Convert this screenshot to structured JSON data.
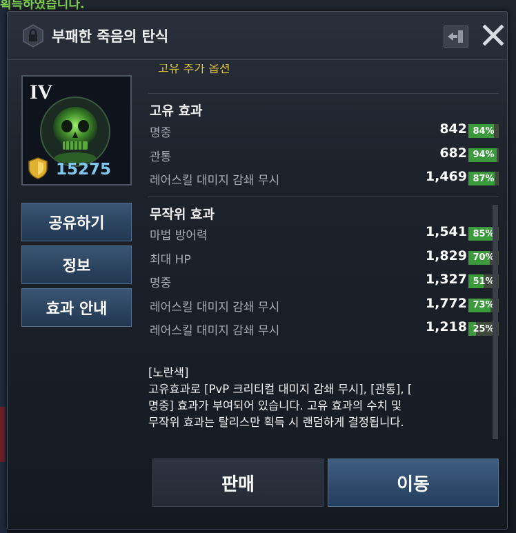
{
  "background": {
    "top_banner_text": "획득하였습니다."
  },
  "dialog": {
    "title": "부패한 죽음의 탄식",
    "header_icon": "lock-hexagon-icon",
    "exit_icon": "exit-arrow-icon",
    "close_icon": "close-icon"
  },
  "item": {
    "tier": "IV",
    "power": "15275",
    "image": "green-skull-icon",
    "power_icon": "gold-shield-icon"
  },
  "side_buttons": {
    "share": "공유하기",
    "info": "정보",
    "effect_guide": "효과 안내"
  },
  "stats": {
    "peek_text": "고유 추가 옵션",
    "unique_title": "고유 효과",
    "unique": [
      {
        "label": "명중",
        "value": "842",
        "pct": "84%",
        "fill": 0.84
      },
      {
        "label": "관통",
        "value": "682",
        "pct": "94%",
        "fill": 0.94
      },
      {
        "label": "레어스킬 대미지 감쇄 무시",
        "value": "1,469",
        "pct": "87%",
        "fill": 0.87
      }
    ],
    "random_title": "무작위 효과",
    "random": [
      {
        "label": "마법 방어력",
        "value": "1,541",
        "pct": "85%",
        "fill": 0.85
      },
      {
        "label": "최대 HP",
        "value": "1,829",
        "pct": "70%",
        "fill": 0.7
      },
      {
        "label": "명중",
        "value": "1,327",
        "pct": "51%",
        "fill": 0.51
      },
      {
        "label": "레어스킬 대미지 감쇄 무시",
        "value": "1,772",
        "pct": "73%",
        "fill": 0.73
      },
      {
        "label": "레어스킬 대미지 감쇄 무시",
        "value": "1,218",
        "pct": "25%",
        "fill": 0.25
      }
    ]
  },
  "description": {
    "line1": "[노란색]",
    "line2": "고유효과로 [PvP 크리티컬 대미지 감쇄 무시], [관통], [",
    "line3": "명중] 효과가 부여되어 있습니다. 고유 효과의 수치 및",
    "line4": "무작위 효과는 탈리스만 획득 시 랜덤하게 결정됩니다."
  },
  "bottom_buttons": {
    "sell": "판매",
    "move": "이동"
  },
  "colors": {
    "accent_blue": "#2d4a6a",
    "pct_green": "#3a9a3c",
    "power_blue": "#7ec8f0"
  }
}
